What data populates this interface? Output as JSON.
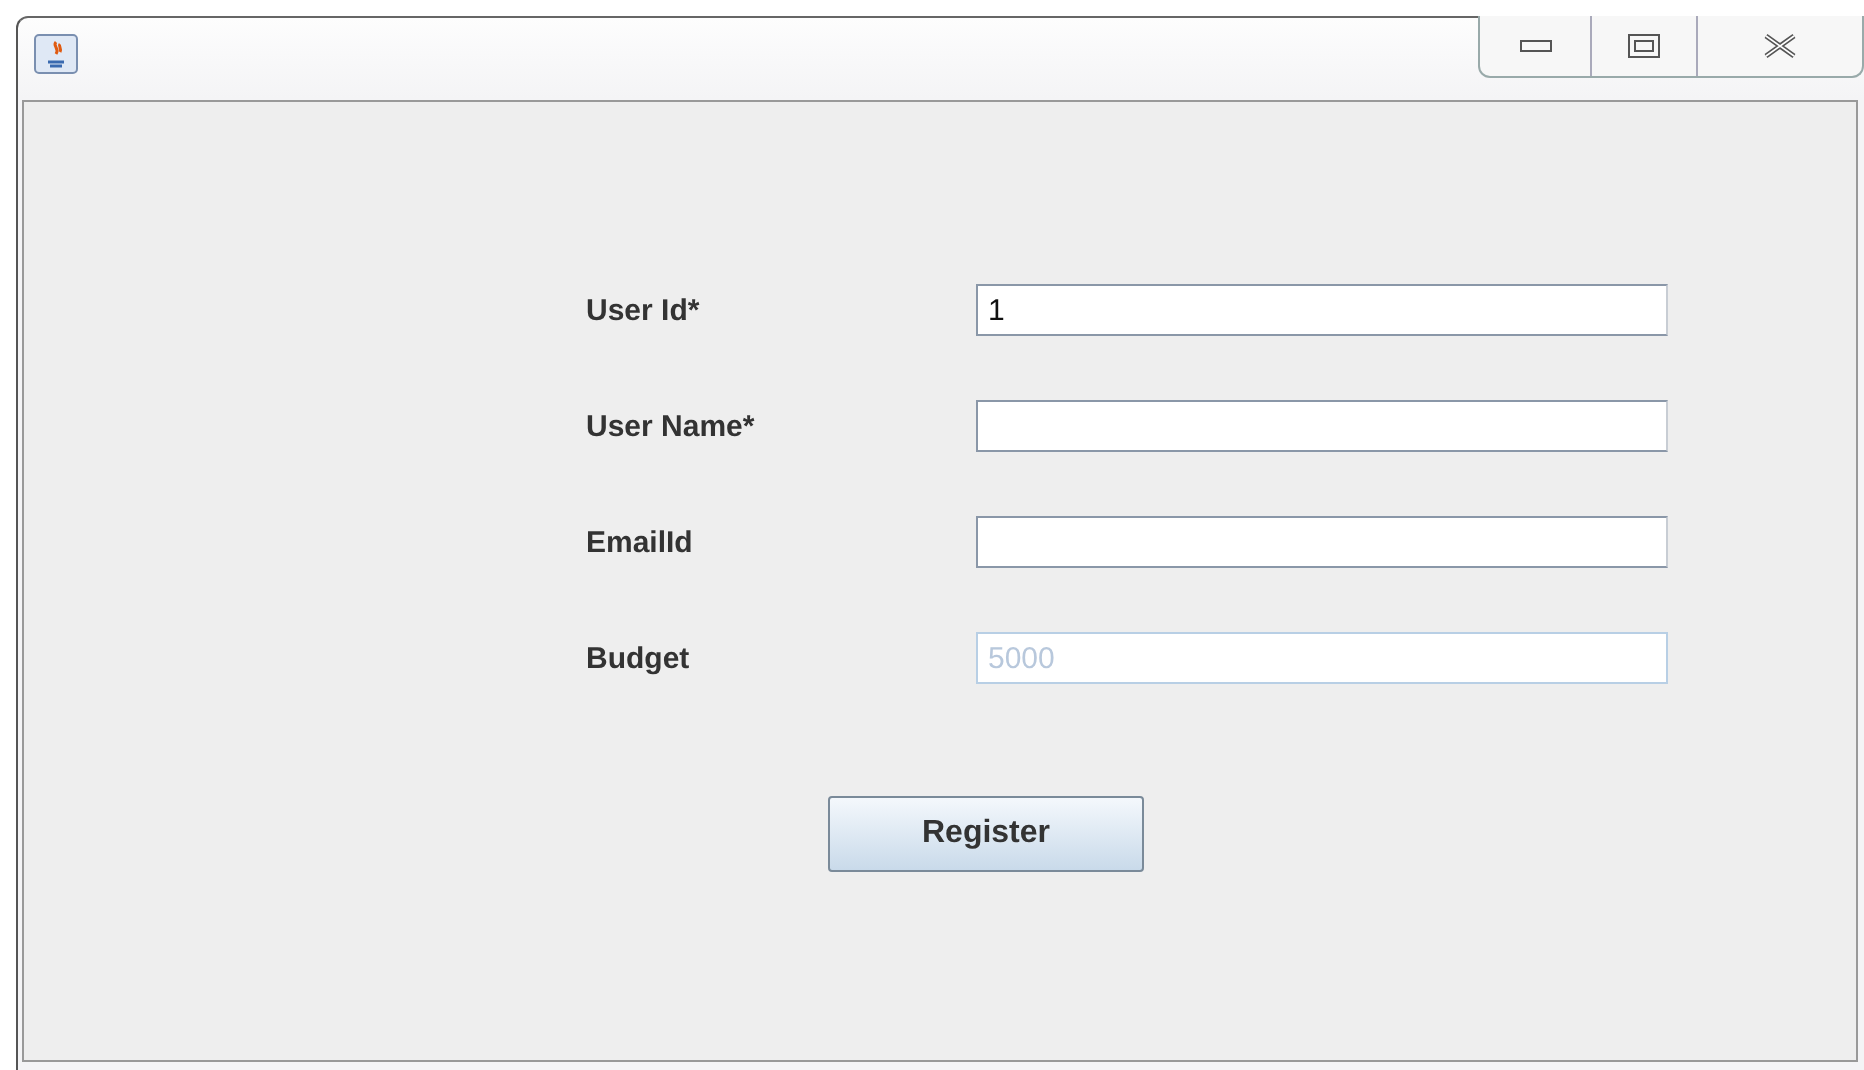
{
  "fields": [
    {
      "label": "User Id*",
      "value": "1",
      "disabled": false
    },
    {
      "label": "User Name*",
      "disabled": false
    },
    {
      "label": "EmailId",
      "disabled": false
    },
    {
      "label": "Budget",
      "value": "5000",
      "disabled": true
    }
  ],
  "buttons": [
    "Register"
  ]
}
